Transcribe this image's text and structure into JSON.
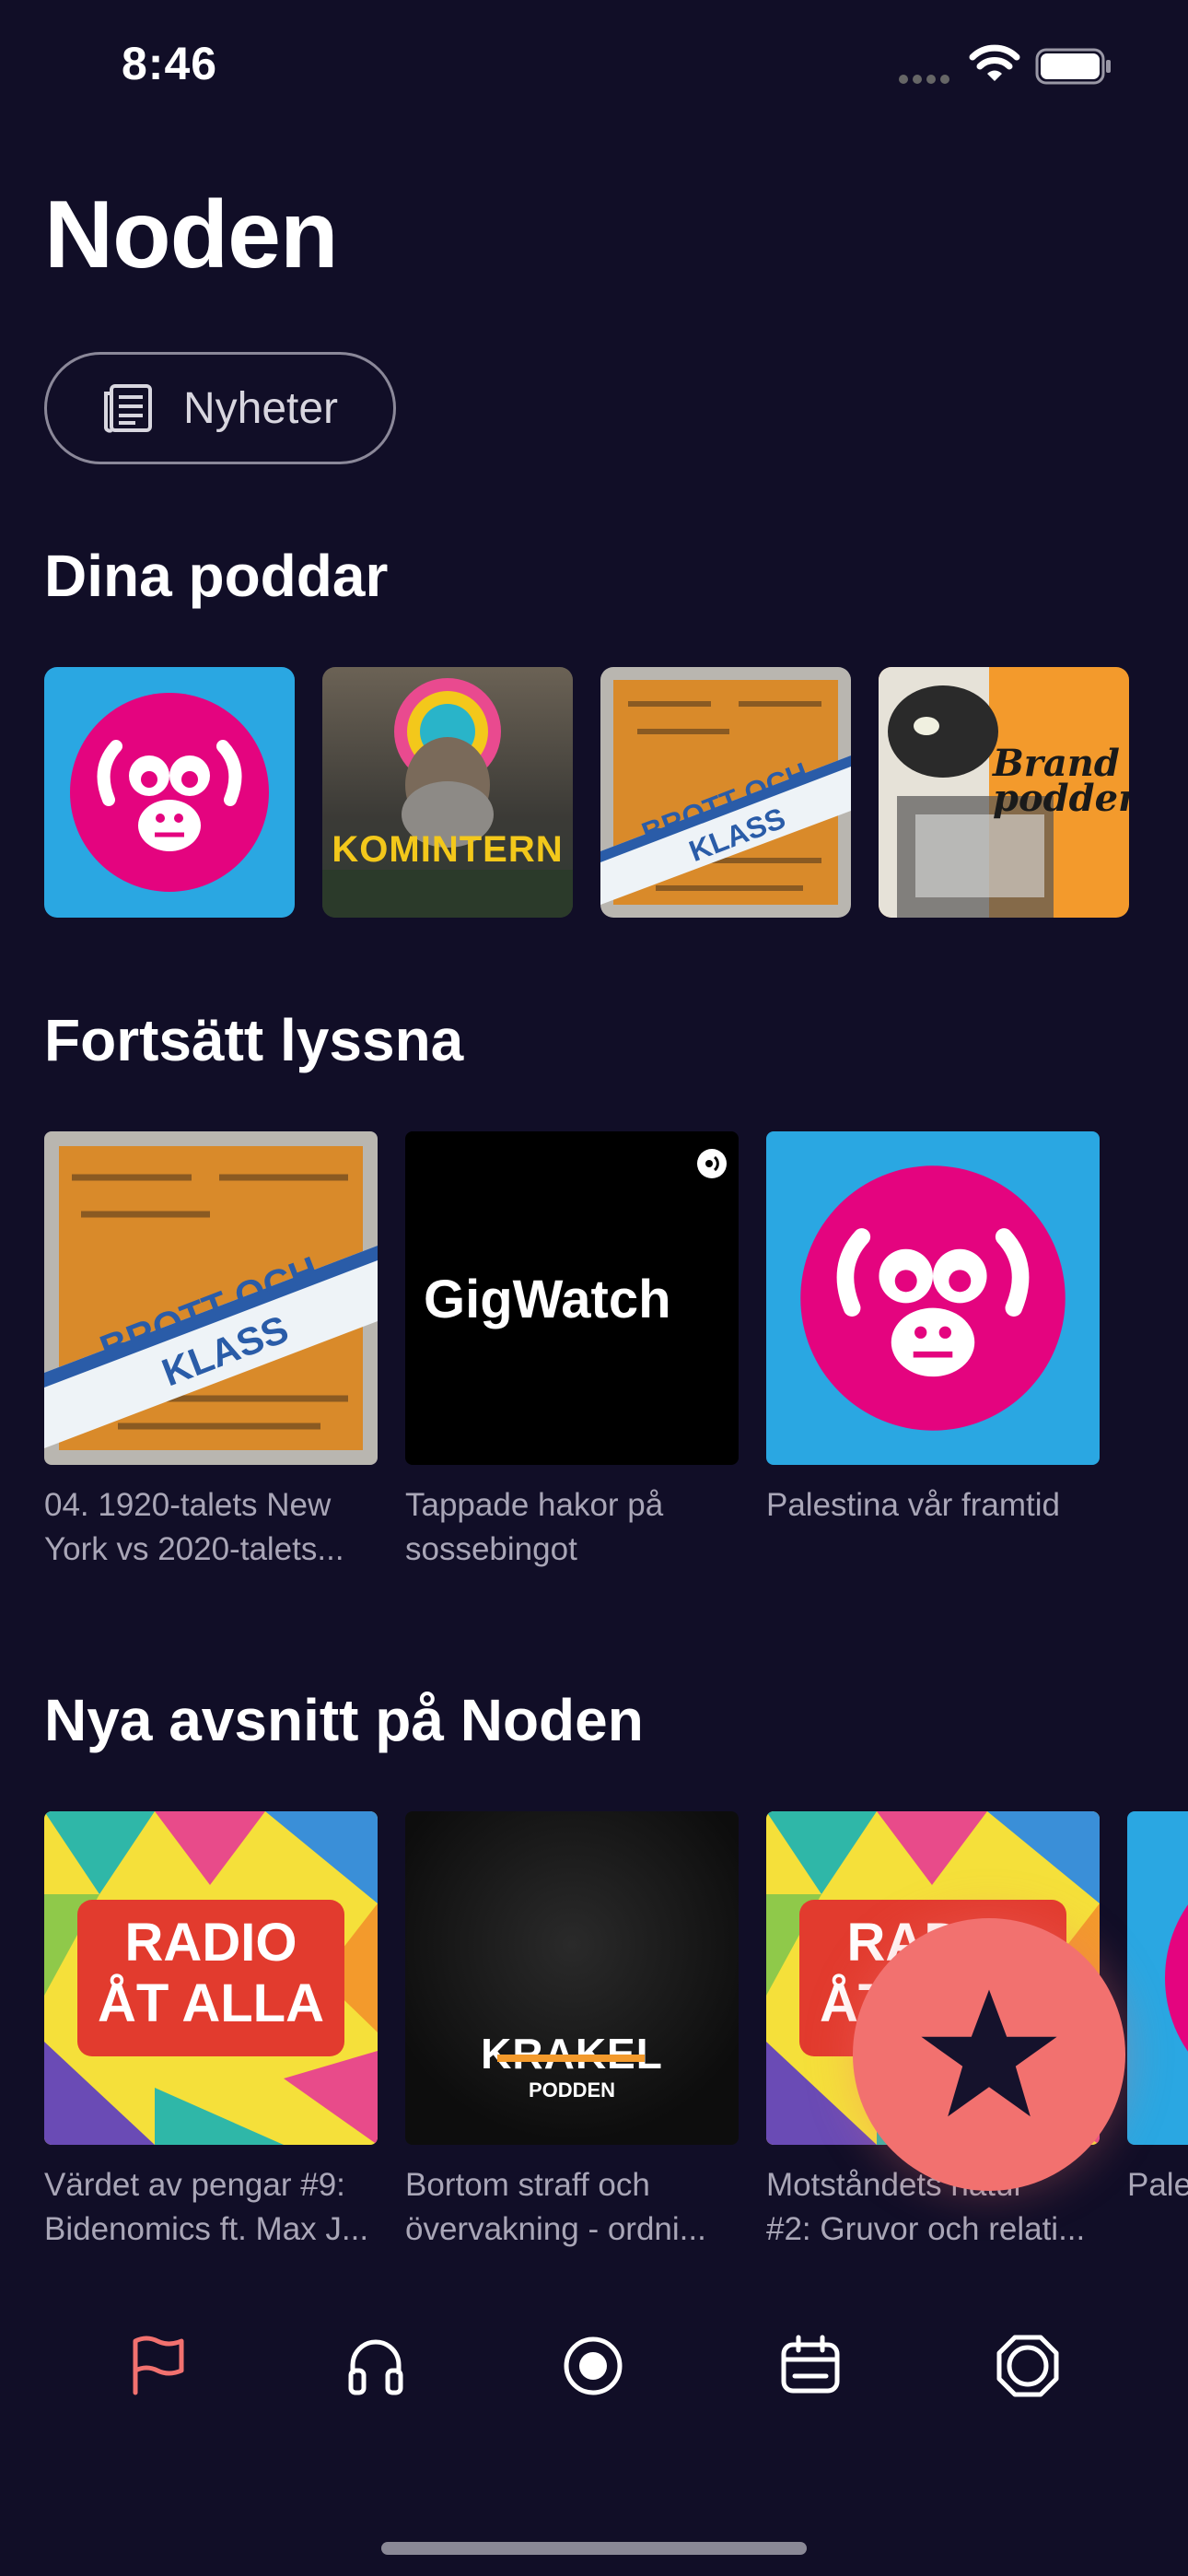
{
  "status": {
    "time": "8:46"
  },
  "page": {
    "title": "Noden"
  },
  "chip": {
    "label": "Nyheter",
    "icon": "newspaper-icon"
  },
  "sections": {
    "subscriptions": "Dina poddar",
    "continue": "Fortsätt lyssna",
    "new_episodes": "Nya avsnitt på Noden"
  },
  "subscriptions": [
    {
      "name": "monkey-podcast"
    },
    {
      "name": "komintern",
      "text": "KOMINTERN"
    },
    {
      "name": "brott-och-klass",
      "text": "BROTT OCH KLASS"
    },
    {
      "name": "brandpodden",
      "text": "Brand podden"
    }
  ],
  "continue_listening": [
    {
      "art": "BROTT OCH KLASS",
      "line1": "04. 1920-talets New",
      "line2": "York vs 2020-talets..."
    },
    {
      "art": "GigWatch",
      "line1": "Tappade hakor på",
      "line2": "sossebingot"
    },
    {
      "art": "",
      "line1": "Palestina vår framtid",
      "line2": ""
    }
  ],
  "new_episodes": [
    {
      "art_line1": "RADIO",
      "art_line2": "ÅT ALLA",
      "line1": "Värdet av pengar #9:",
      "line2": "Bidenomics ft. Max J..."
    },
    {
      "art_line1": "KRAKEL",
      "art_line2": "PODDEN",
      "line1": "Bortom straff och",
      "line2": "övervakning - ordni..."
    },
    {
      "art_line1": "RADIO",
      "art_line2": "ÅT ALLA",
      "line1": "Motståndets natur",
      "line2": "#2: Gruvor och relati..."
    },
    {
      "art_line1": "",
      "art_line2": "",
      "line1": "Pale",
      "line2": ""
    }
  ],
  "tabs": [
    {
      "name": "tab-home",
      "icon": "flag-icon",
      "active": true
    },
    {
      "name": "tab-podcasts",
      "icon": "headphones-icon",
      "active": false
    },
    {
      "name": "tab-live",
      "icon": "record-icon",
      "active": false
    },
    {
      "name": "tab-calendar",
      "icon": "calendar-icon",
      "active": false
    },
    {
      "name": "tab-settings",
      "icon": "ring-icon",
      "active": false
    }
  ],
  "colors": {
    "background": "#110e27",
    "accent": "#f2716f",
    "sky": "#2aa7e2",
    "pink": "#e4047f",
    "orange": "#d98a2a"
  }
}
